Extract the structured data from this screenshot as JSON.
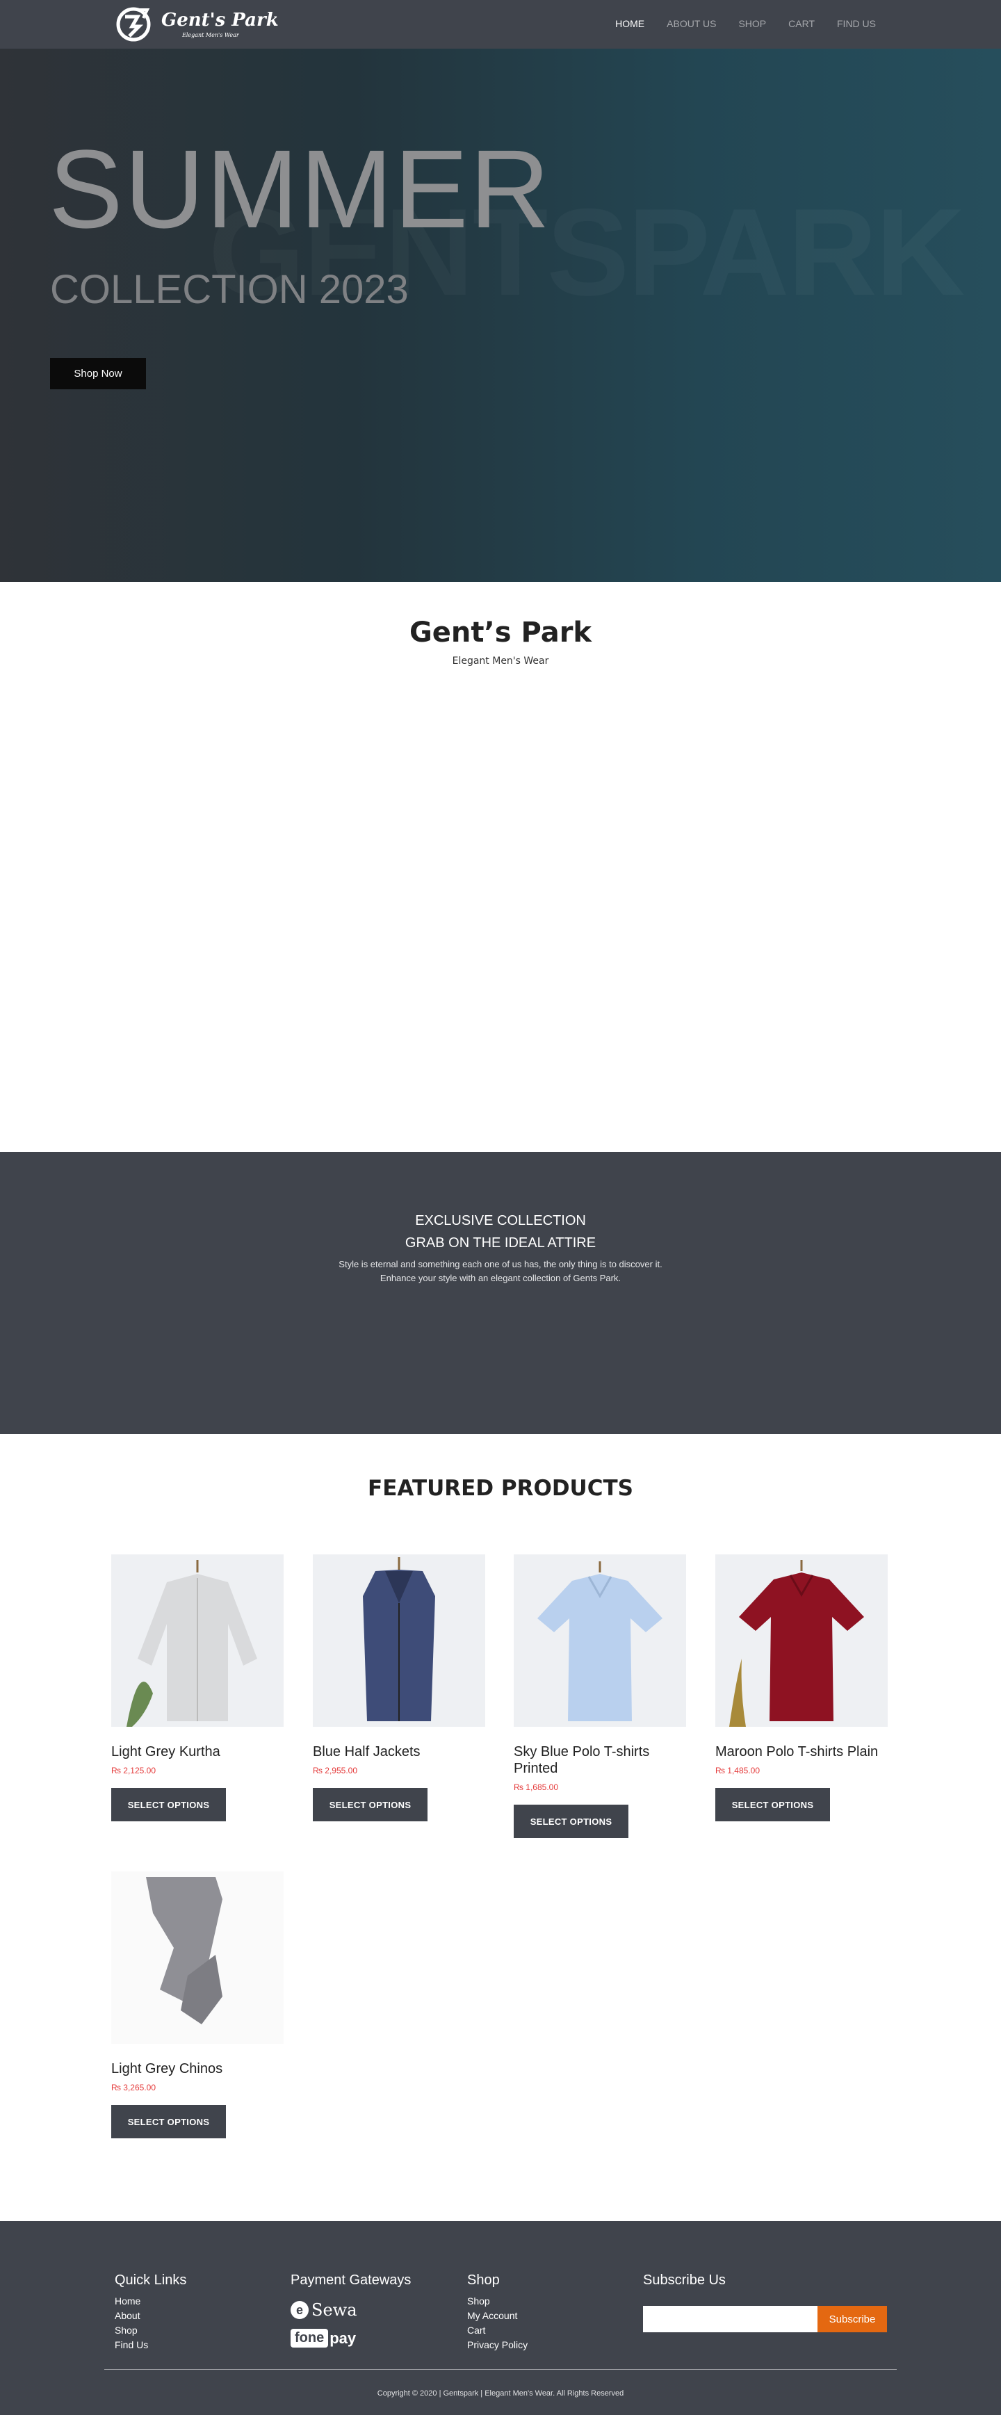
{
  "nav": {
    "brand": "Gent's Park",
    "brand_sub": "Elegant Men's Wear",
    "items": [
      {
        "label": "HOME",
        "active": true
      },
      {
        "label": "ABOUT US"
      },
      {
        "label": "SHOP"
      },
      {
        "label": "CART"
      },
      {
        "label": "FIND US"
      }
    ]
  },
  "hero": {
    "watermark": "GENTSPARK",
    "title": "SUMMER",
    "subtitle": "COLLECTION 2023",
    "button": "Shop Now"
  },
  "brand": {
    "title": "Gent’s Park",
    "subtitle": "Elegant Men's Wear"
  },
  "exclusive": {
    "heading1": "EXCLUSIVE COLLECTION",
    "heading2": "GRAB ON THE IDEAL ATTIRE",
    "line1": "Style is eternal and something each one of us has, the only thing is to discover it.",
    "line2": "Enhance your style with an elegant collection of Gents Park."
  },
  "featured": {
    "title": "FEATURED PRODUCTS",
    "products": [
      {
        "name": "Light Grey Kurtha",
        "price": "₨ 2,125.00",
        "button": "SELECT OPTIONS",
        "color": "#d9dadc"
      },
      {
        "name": "Blue Half Jackets",
        "price": "₨ 2,955.00",
        "button": "SELECT OPTIONS",
        "color": "#3e4c78"
      },
      {
        "name": "Sky Blue Polo T-shirts Printed",
        "price": "₨ 1,685.00",
        "button": "SELECT OPTIONS",
        "color": "#b9d0ee"
      },
      {
        "name": "Maroon Polo T-shirts Plain",
        "price": "₨ 1,485.00",
        "button": "SELECT OPTIONS",
        "color": "#8e1222"
      },
      {
        "name": "Light Grey Chinos",
        "price": "₨ 3,265.00",
        "button": "SELECT OPTIONS",
        "color": "#8f8f95"
      }
    ]
  },
  "footer": {
    "quick_links": {
      "title": "Quick Links",
      "items": [
        "Home",
        "About",
        "Shop",
        "Find Us"
      ]
    },
    "payment": {
      "title": "Payment Gateways",
      "esewa": "Sewa",
      "esewa_mark": "e",
      "fone": "fone",
      "pay": "pay"
    },
    "shop": {
      "title": "Shop",
      "items": [
        "Shop",
        "My Account",
        "Cart",
        "Privacy Policy"
      ]
    },
    "subscribe": {
      "title": "Subscribe Us",
      "placeholder": "",
      "button": "Subscribe"
    },
    "copyright": "Copyright © 2020 | Gentspark | Elegant Men's Wear. All Rights Reserved"
  },
  "colors": {
    "nav_bg": "#40444c",
    "accent_orange": "#e46811",
    "price_red": "#e43a3a"
  }
}
